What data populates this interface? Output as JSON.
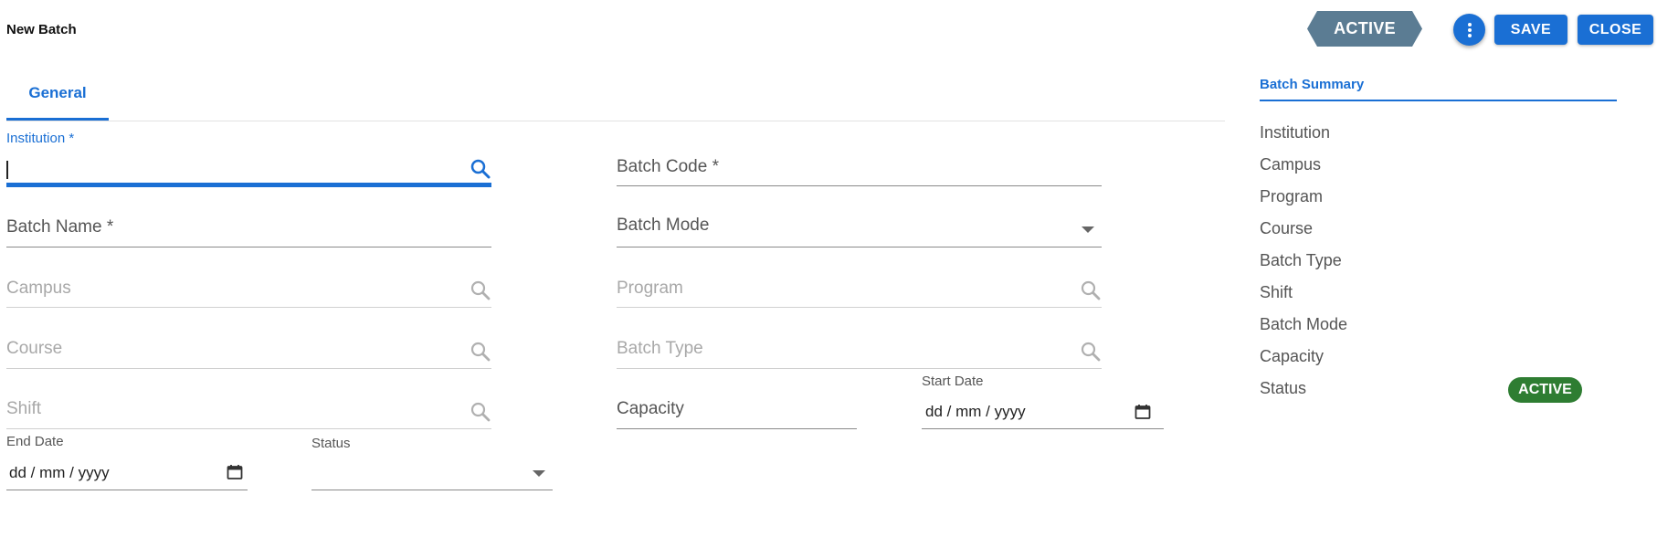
{
  "header": {
    "title": "New Batch",
    "status_tag": "ACTIVE",
    "more_icon": "more-vert-icon",
    "save_label": "SAVE",
    "close_label": "CLOSE"
  },
  "tabs": [
    {
      "label": "General",
      "active": true
    }
  ],
  "form": {
    "institution": {
      "label": "Institution *",
      "value": "",
      "icon": "search-icon"
    },
    "batch_code": {
      "label": "Batch Code *",
      "value": ""
    },
    "batch_name": {
      "label": "Batch Name *",
      "value": ""
    },
    "batch_mode": {
      "label": "Batch Mode",
      "value": "",
      "icon": "dropdown-arrow-icon"
    },
    "campus": {
      "label": "Campus",
      "value": "",
      "icon": "search-icon"
    },
    "program": {
      "label": "Program",
      "value": "",
      "icon": "search-icon"
    },
    "course": {
      "label": "Course",
      "value": "",
      "icon": "search-icon"
    },
    "batch_type": {
      "label": "Batch Type",
      "value": "",
      "icon": "search-icon"
    },
    "shift": {
      "label": "Shift",
      "value": "",
      "icon": "search-icon"
    },
    "capacity": {
      "label": "Capacity",
      "value": ""
    },
    "start_date": {
      "label": "Start Date",
      "value": "dd / mm / yyyy",
      "icon": "calendar-icon"
    },
    "end_date": {
      "label": "End Date",
      "value": "dd / mm / yyyy",
      "icon": "calendar-icon"
    },
    "status": {
      "label": "Status",
      "value": "",
      "icon": "dropdown-arrow-icon"
    }
  },
  "summary": {
    "title": "Batch Summary",
    "items": [
      "Institution",
      "Campus",
      "Program",
      "Course",
      "Batch Type",
      "Shift",
      "Batch Mode",
      "Capacity",
      "Status"
    ],
    "status_badge": "ACTIVE"
  },
  "colors": {
    "primary": "#1a6fd4",
    "status_tag": "#5b7c93",
    "active_badge": "#2e7d32"
  }
}
